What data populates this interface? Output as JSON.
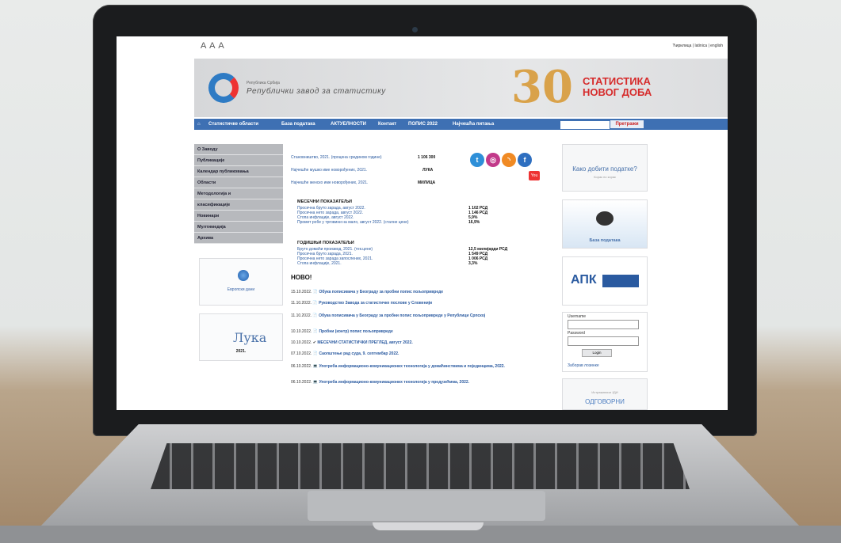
{
  "page": {
    "a11y_label": "A A A",
    "languages": "Ћирилица | latinica | english"
  },
  "banner": {
    "org_small": "Република Србија",
    "org_name": "Републички завод за статистику",
    "anniversary": "30",
    "slogan_line1": "СТАТИСТИКА",
    "slogan_line2": "НОВОГ ДОБА"
  },
  "nav": {
    "items": [
      "Статистичке области",
      "База података",
      "АКТУЕЛНОСТИ",
      "Контакт",
      "ПОПИС 2022",
      "Најчешћа питања"
    ],
    "search_button": "Претражи"
  },
  "left_menu": [
    "О Заводу",
    "Публикације",
    "Календар публиковања",
    "Области",
    "Методологија и",
    "класификације",
    "Новинари",
    "Мултимедија",
    "Архива"
  ],
  "left_cards": {
    "card1": "Европски дани",
    "card2_logo": "Лука",
    "card2_year": "2021."
  },
  "headline": {
    "rows": [
      {
        "label": "Становништво, 2021. (процена средином године)",
        "value": "1 106 300"
      },
      {
        "label": "Најчешће мушко име новорођених, 2021.",
        "value": "ЛУКА"
      },
      {
        "label": "Најчешће женско име новорођених, 2021.",
        "value": "МИЛИЦА"
      }
    ]
  },
  "monthly": {
    "title": "МЕСЕЧНИ ПОКАЗАТЕЉИ",
    "rows": [
      {
        "label": "Просечна бруто зарада, август 2022.",
        "value": "1 102 РСД"
      },
      {
        "label": "Просечна нето зарада, август 2022.",
        "value": "1 146 РСД"
      },
      {
        "label": "Стопа инфлације, август 2022.",
        "value": "5,9%"
      },
      {
        "label": "Промет робе у трговини на мало, август 2022. (сталне цене)",
        "value": "16,9%"
      }
    ]
  },
  "annual": {
    "title": "ГОДИШЊИ ПОКАЗАТЕЉИ",
    "rows": [
      {
        "label": "Бруто домаћи производ, 2021. (тек.цене)",
        "value": "12,5 милијарди РСД"
      },
      {
        "label": "Просечна бруто зарада, 2021.",
        "value": "1 549 РСД"
      },
      {
        "label": "Просечна нето зарада запослених, 2021.",
        "value": "1 006 РСД"
      },
      {
        "label": "Стопа инфлације, 2021.",
        "value": "3,3%"
      }
    ]
  },
  "news": {
    "title": "НОВО!",
    "items": [
      {
        "date": "15.10.2022.",
        "text": "Обука пописивача у Београду за пробни попис пољопривреде"
      },
      {
        "date": "11.10.2022.",
        "text": "Руководство Завода за статистичке послове у Словенији"
      },
      {
        "date": "11.10.2022.",
        "text": "Обука пописивача у Београду за пробни попис пољопривреде у Републици Српској"
      },
      {
        "date": "10.10.2022.",
        "text": "Пробни (контр) попис пољопривреде"
      },
      {
        "date": "10.10.2022.",
        "text": "МЕСЕЧНИ СТАТИСТИЧКИ ПРЕГЛЕД, август 2022."
      },
      {
        "date": "07.10.2022.",
        "text": "Саопштење рад суда, 9. септембар 2022."
      },
      {
        "date": "06.10.2022.",
        "text": "Употреба информационо-комуникационих технологија у домаћинствима и појединцима, 2022."
      },
      {
        "date": "06.10.2022.",
        "text": "Употреба информационо-комуникационих технологија у предузећима, 2022."
      }
    ]
  },
  "social": {
    "youtube": "You Tube"
  },
  "right": {
    "card1": "Како добити податке?",
    "card1_sub": "Корак по корак",
    "card2": "База података",
    "card3": "АПК",
    "login": {
      "username_label": "Username",
      "password_label": "Password",
      "login_button": "Login",
      "forgot": "Заборав лозинке"
    },
    "card5_small": "Истраживачи ЈДИ",
    "card5": "ОДГОВОРНИ"
  }
}
